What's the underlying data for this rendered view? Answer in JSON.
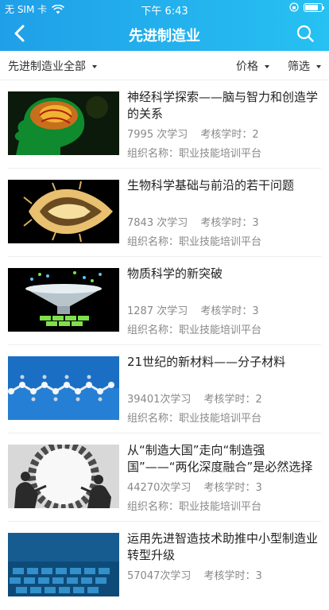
{
  "status": {
    "carrier": "无 SIM 卡",
    "time": "下午 6:43",
    "battery_level": 0.82
  },
  "nav": {
    "title": "先进制造业",
    "back_icon": "back-chevron-icon",
    "search_icon": "search-icon"
  },
  "filters": {
    "category": "先进制造业全部",
    "price": "价格",
    "screen": "筛选"
  },
  "items": [
    {
      "title": "神经科学探索——脑与智力和创造学的关系",
      "views": "7995 次学习",
      "hours": "考核学时：2",
      "org": "组织名称：职业技能培训平台"
    },
    {
      "title": "生物科学基础与前沿的若干问题",
      "views": "7843 次学习",
      "hours": "考核学时：3",
      "org": "组织名称：职业技能培训平台"
    },
    {
      "title": "物质科学的新突破",
      "views": "1287 次学习",
      "hours": "考核学时：3",
      "org": "组织名称：职业技能培训平台"
    },
    {
      "title": "21世纪的新材料——分子材料",
      "views": "39401次学习",
      "hours": "考核学时：2",
      "org": "组织名称：职业技能培训平台"
    },
    {
      "title": "从“制造大国”走向“制造强国”——“两化深度融合”是必然选择",
      "views": "44270次学习",
      "hours": "考核学时：3",
      "org": "组织名称：职业技能培训平台"
    },
    {
      "title": "运用先进智造技术助推中小型制造业转型升级",
      "views": "57047次学习",
      "hours": "考核学时：3",
      "org": ""
    }
  ]
}
